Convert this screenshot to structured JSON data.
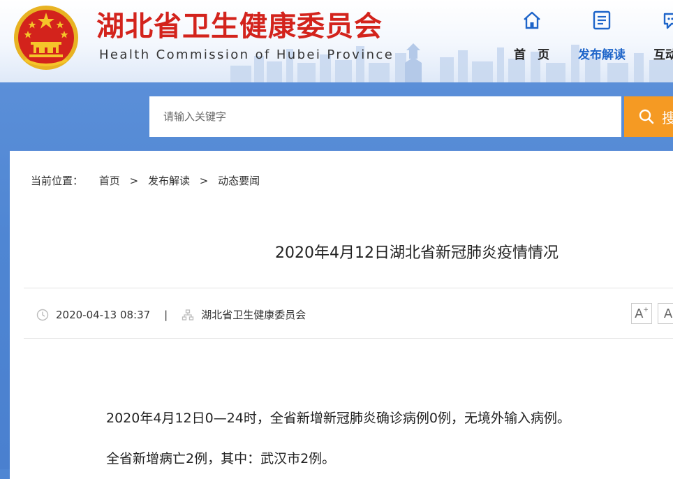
{
  "header": {
    "title": "湖北省卫生健康委员会",
    "subtitle": "Health Commission of Hubei Province",
    "nav": [
      {
        "label": "首　页",
        "icon": "home-icon"
      },
      {
        "label": "发布解读",
        "icon": "document-list-icon"
      },
      {
        "label": "互动",
        "icon": "chat-icon"
      }
    ]
  },
  "search": {
    "placeholder": "请输入关键字",
    "button_label": "搜"
  },
  "breadcrumb": {
    "prefix": "当前位置：",
    "items": [
      "首页",
      "发布解读",
      "动态要闻"
    ],
    "separator": ">"
  },
  "article": {
    "title": "2020年4月12日湖北省新冠肺炎疫情情况",
    "date": "2020-04-13 08:37",
    "meta_separator": "|",
    "source": "湖北省卫生健康委员会",
    "font_larger": "A",
    "font_smaller": "A",
    "paragraphs": [
      "2020年4月12日0—24时，全省新增新冠肺炎确诊病例0例，无境外输入病例。",
      "全省新增病亡2例，其中：武汉市2例。"
    ]
  },
  "colors": {
    "brand_red": "#d3231c",
    "nav_active": "#1d64c9",
    "search_button": "#f59a23",
    "band_blue": "#4f86d3"
  }
}
